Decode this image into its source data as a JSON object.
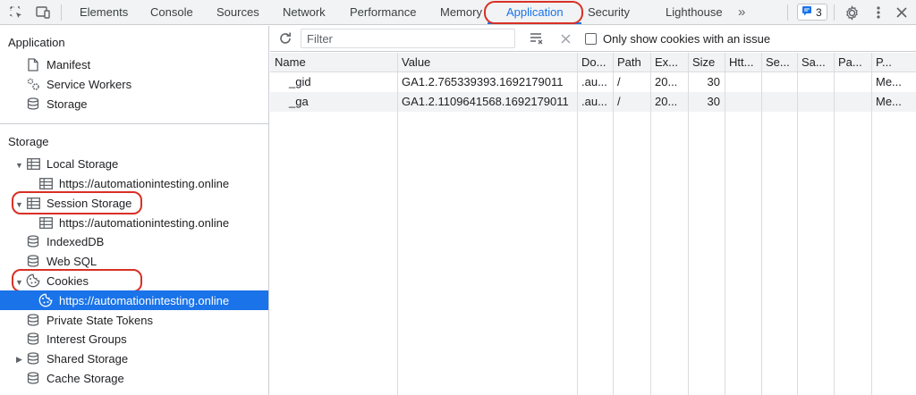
{
  "toolbar": {
    "tabs": [
      "Elements",
      "Console",
      "Sources",
      "Network",
      "Performance",
      "Memory",
      "Application",
      "Security",
      "Lighthouse"
    ],
    "more_tabs_glyph": "»",
    "issues_count": "3",
    "icons": [
      "inspect-element-icon",
      "device-toggle-icon",
      "more-tabs-icon",
      "issues-icon",
      "settings-gear-icon",
      "kebab-menu-icon",
      "close-icon"
    ]
  },
  "sidebar": {
    "application_heading": "Application",
    "application_items": [
      {
        "label": "Manifest",
        "icon": "document-icon"
      },
      {
        "label": "Service Workers",
        "icon": "gears-icon"
      },
      {
        "label": "Storage",
        "icon": "database-icon"
      }
    ],
    "storage_heading": "Storage",
    "storage_items": [
      {
        "label": "Local Storage",
        "icon": "table-icon"
      },
      {
        "label": "https://automationintesting.online",
        "icon": "table-icon"
      },
      {
        "label": "Session Storage",
        "icon": "table-icon"
      },
      {
        "label": "https://automationintesting.online",
        "icon": "table-icon"
      },
      {
        "label": "IndexedDB",
        "icon": "database-icon"
      },
      {
        "label": "Web SQL",
        "icon": "database-icon"
      },
      {
        "label": "Cookies",
        "icon": "cookie-icon"
      },
      {
        "label": "https://automationintesting.online",
        "icon": "cookie-icon"
      },
      {
        "label": "Private State Tokens",
        "icon": "database-icon"
      },
      {
        "label": "Interest Groups",
        "icon": "database-icon"
      },
      {
        "label": "Shared Storage",
        "icon": "database-icon"
      },
      {
        "label": "Cache Storage",
        "icon": "database-icon"
      }
    ]
  },
  "cookies": {
    "filter_placeholder": "Filter",
    "only_issues_label": "Only show cookies with an issue",
    "only_issues_checked": false,
    "columns": [
      "Name",
      "Value",
      "Do...",
      "Path",
      "Ex...",
      "Size",
      "Htt...",
      "Se...",
      "Sa...",
      "Pa...",
      "P..."
    ],
    "rows": [
      [
        "_gid",
        "GA1.2.765339393.1692179011",
        ".au...",
        "/",
        "20...",
        "30",
        "",
        "",
        "",
        "",
        "Me..."
      ],
      [
        "_ga",
        "GA1.2.1109641568.1692179011",
        ".au...",
        "/",
        "20...",
        "30",
        "",
        "",
        "",
        "",
        "Me..."
      ]
    ]
  },
  "colors": {
    "accent": "#1a73e8",
    "highlight_ring": "#d93025",
    "toolbar_bg": "#f1f3f4"
  }
}
